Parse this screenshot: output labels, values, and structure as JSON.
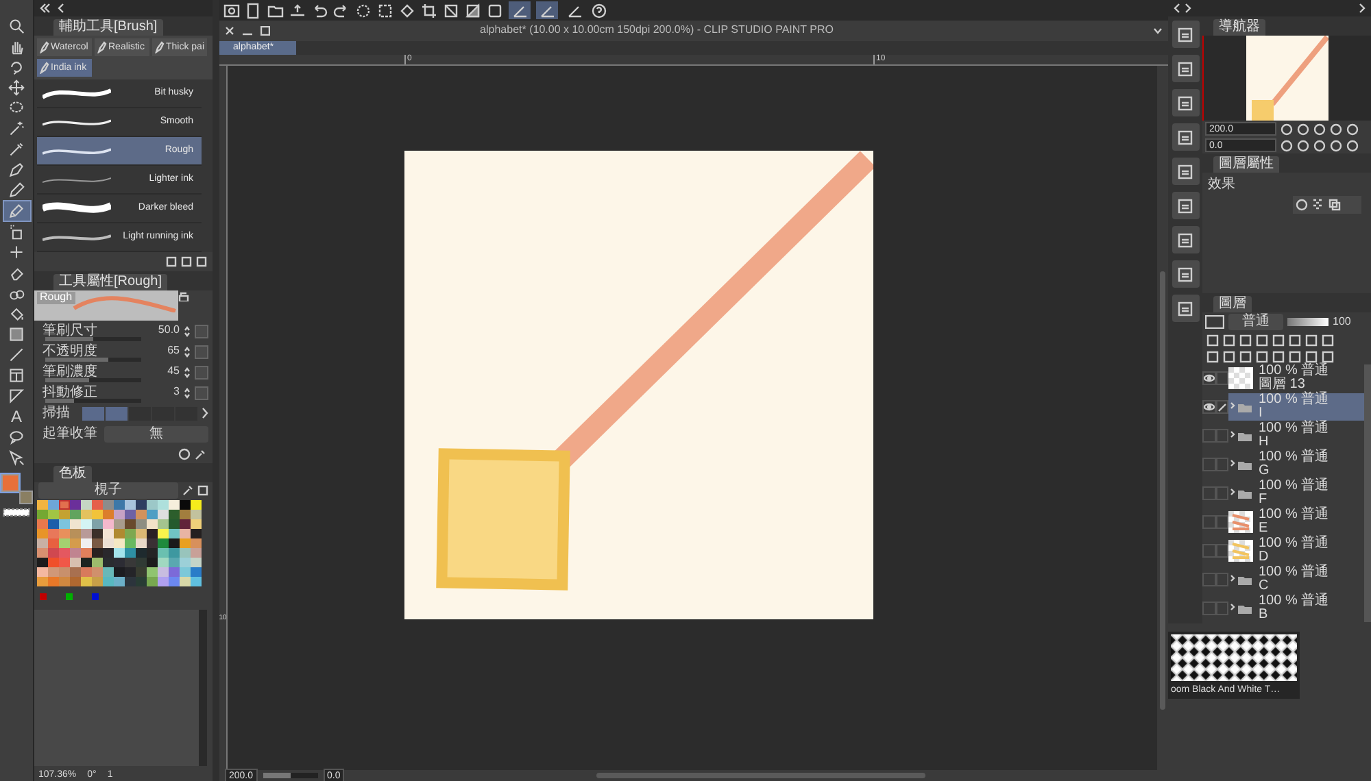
{
  "tools": [
    {
      "kind": "zoom",
      "selected": false
    },
    {
      "kind": "hand",
      "selected": false
    },
    {
      "kind": "rotate",
      "selected": false
    },
    {
      "kind": "move",
      "selected": false
    },
    {
      "kind": "lasso",
      "selected": false
    },
    {
      "kind": "wand",
      "selected": false
    },
    {
      "kind": "eyedropper",
      "selected": false
    },
    {
      "kind": "pen",
      "selected": false
    },
    {
      "kind": "pencil",
      "selected": false
    },
    {
      "kind": "brush",
      "selected": true
    },
    {
      "kind": "airbrush",
      "selected": false
    },
    {
      "kind": "decoration",
      "selected": false
    },
    {
      "kind": "eraser",
      "selected": false
    },
    {
      "kind": "blend",
      "selected": false
    },
    {
      "kind": "fill",
      "selected": false
    },
    {
      "kind": "gradient",
      "selected": false
    },
    {
      "kind": "figure",
      "selected": false
    },
    {
      "kind": "frame",
      "selected": false
    },
    {
      "kind": "ruler",
      "selected": false
    },
    {
      "kind": "text",
      "selected": false,
      "glyph": "A"
    },
    {
      "kind": "balloon",
      "selected": false
    },
    {
      "kind": "correct",
      "selected": false
    }
  ],
  "color_chips": [
    {
      "color": "#e8703a",
      "selected": true
    },
    {
      "color": "#8a7f62",
      "selected": false
    }
  ],
  "subtool": {
    "title": "輔助工具[Brush]",
    "groups": [
      {
        "label": "Watercol",
        "selected": false
      },
      {
        "label": "Realistic",
        "selected": false
      },
      {
        "label": "Thick pai",
        "selected": false
      },
      {
        "label": "India ink",
        "selected": true
      }
    ],
    "brushes": [
      {
        "name": "Bit husky",
        "selected": false
      },
      {
        "name": "Smooth",
        "selected": false
      },
      {
        "name": "Rough",
        "selected": true
      },
      {
        "name": "Lighter ink",
        "selected": false
      },
      {
        "name": "Darker bleed",
        "selected": false
      },
      {
        "name": "Light running ink",
        "selected": false
      }
    ]
  },
  "tool_property": {
    "title": "工具屬性[Rough]",
    "preview_label": "Rough",
    "params": [
      {
        "kind": "slider",
        "label": "筆刷尺寸",
        "value": "50.0",
        "level": 0.5
      },
      {
        "kind": "slider",
        "label": "不透明度",
        "value": "65",
        "level": 0.65
      },
      {
        "kind": "slider",
        "label": "筆刷濃度",
        "value": "45",
        "level": 0.45
      },
      {
        "kind": "slider",
        "label": "抖動修正",
        "value": "3",
        "level": 0.3
      },
      {
        "kind": "steps",
        "label": "掃描",
        "steps": [
          {
            "on": true
          },
          {
            "on": true
          },
          {
            "on": false
          },
          {
            "on": false
          },
          {
            "on": false
          }
        ]
      },
      {
        "kind": "dropdown",
        "label": "起筆收筆",
        "value": "無"
      }
    ]
  },
  "color_palette": {
    "tab_label": "色板",
    "set_name": "梘子",
    "swatches": [
      {
        "color": "#f2b441",
        "selected": false
      },
      {
        "color": "#6ea6d8",
        "selected": false
      },
      {
        "color": "#e2704e",
        "selected": true
      },
      {
        "color": "#6b2f9a",
        "selected": false
      },
      {
        "color": "#c5d6c4",
        "selected": false
      },
      {
        "color": "#e5604a",
        "selected": false
      },
      {
        "color": "#8c8c8c",
        "selected": false
      },
      {
        "color": "#3d78a8",
        "selected": false
      },
      {
        "color": "#a8c4de",
        "selected": false
      },
      {
        "color": "#2e3e62",
        "selected": false
      },
      {
        "color": "#9cc8c8",
        "selected": false
      },
      {
        "color": "#aee0dc",
        "selected": false
      },
      {
        "color": "#f6eedc",
        "selected": false
      },
      {
        "color": "#0a0a0a",
        "selected": false
      },
      {
        "color": "#f5ec1c",
        "selected": false
      },
      {
        "color": "#74a832",
        "selected": false
      },
      {
        "color": "#a2c544",
        "selected": false
      },
      {
        "color": "#c4a232",
        "selected": false
      },
      {
        "color": "#62a45e",
        "selected": false
      },
      {
        "color": "#e3c25e",
        "selected": false
      },
      {
        "color": "#f2c33a",
        "selected": false
      },
      {
        "color": "#dc7e2c",
        "selected": false
      },
      {
        "color": "#c6a2c4",
        "selected": false
      },
      {
        "color": "#6e62a4",
        "selected": false
      },
      {
        "color": "#d2925c",
        "selected": false
      },
      {
        "color": "#4e9ec4",
        "selected": false
      },
      {
        "color": "#dedede",
        "selected": false
      },
      {
        "color": "#2c5e2c",
        "selected": false
      },
      {
        "color": "#a27e3e",
        "selected": false
      },
      {
        "color": "#c2c29e",
        "selected": false
      },
      {
        "color": "#e8784c",
        "selected": false
      },
      {
        "color": "#1d5eaa",
        "selected": false
      },
      {
        "color": "#7cc4de",
        "selected": false
      },
      {
        "color": "#f0e4d0",
        "selected": false
      },
      {
        "color": "#d4f4f4",
        "selected": false
      },
      {
        "color": "#7ea2a8",
        "selected": false
      },
      {
        "color": "#f4b8cc",
        "selected": false
      },
      {
        "color": "#a89c8c",
        "selected": false
      },
      {
        "color": "#684a2c",
        "selected": false
      },
      {
        "color": "#8e8e82",
        "selected": false
      },
      {
        "color": "#f2e2c8",
        "selected": false
      },
      {
        "color": "#a4c48e",
        "selected": false
      },
      {
        "color": "#245a2e",
        "selected": false
      },
      {
        "color": "#62243a",
        "selected": false
      },
      {
        "color": "#f0d07a",
        "selected": false
      },
      {
        "color": "#e89428",
        "selected": false
      },
      {
        "color": "#e8785a",
        "selected": false
      },
      {
        "color": "#e8905c",
        "selected": false
      },
      {
        "color": "#b8905a",
        "selected": false
      },
      {
        "color": "#b89a98",
        "selected": false
      },
      {
        "color": "#3c302a",
        "selected": false
      },
      {
        "color": "#f4e4d4",
        "selected": false
      },
      {
        "color": "#b08a30",
        "selected": false
      },
      {
        "color": "#7ea850",
        "selected": false
      },
      {
        "color": "#dcb874",
        "selected": false
      },
      {
        "color": "#2a2024",
        "selected": false
      },
      {
        "color": "#f8f44c",
        "selected": false
      },
      {
        "color": "#70c4c4",
        "selected": false
      },
      {
        "color": "#e8b4a4",
        "selected": false
      },
      {
        "color": "#242020",
        "selected": false
      },
      {
        "color": "#c8b0a4",
        "selected": false
      },
      {
        "color": "#e86040",
        "selected": false
      },
      {
        "color": "#a4d070",
        "selected": false
      },
      {
        "color": "#d49c4c",
        "selected": false
      },
      {
        "color": "#f0f0f0",
        "selected": false
      },
      {
        "color": "#7a5a44",
        "selected": false
      },
      {
        "color": "#ece0d4",
        "selected": false
      },
      {
        "color": "#f4e8c4",
        "selected": false
      },
      {
        "color": "#68b860",
        "selected": false
      },
      {
        "color": "#e8d8c8",
        "selected": false
      },
      {
        "color": "#3a3034",
        "selected": false
      },
      {
        "color": "#1e8a3c",
        "selected": false
      },
      {
        "color": "#1a1a1a",
        "selected": false
      },
      {
        "color": "#e8a020",
        "selected": false
      },
      {
        "color": "#d8905c",
        "selected": false
      },
      {
        "color": "#d89070",
        "selected": false
      },
      {
        "color": "#d04850",
        "selected": false
      },
      {
        "color": "#e45860",
        "selected": false
      },
      {
        "color": "#c08490",
        "selected": false
      },
      {
        "color": "#e0805c",
        "selected": false
      },
      {
        "color": "#2a2220",
        "selected": false
      },
      {
        "color": "#2a282c",
        "selected": false
      },
      {
        "color": "#a4e4ec",
        "selected": false
      },
      {
        "color": "#2e90a4",
        "selected": false
      },
      {
        "color": "#1e2a2e",
        "selected": false
      },
      {
        "color": "#242424",
        "selected": false
      },
      {
        "color": "#6ac0b0",
        "selected": false
      },
      {
        "color": "#3e98a0",
        "selected": false
      },
      {
        "color": "#98c4bc",
        "selected": false
      },
      {
        "color": "#c8a098",
        "selected": false
      },
      {
        "color": "#1c1c1c",
        "selected": false
      },
      {
        "color": "#f0502a",
        "selected": false
      },
      {
        "color": "#f05848",
        "selected": false
      },
      {
        "color": "#d8c0b0",
        "selected": false
      },
      {
        "color": "#1c2420",
        "selected": false
      },
      {
        "color": "#9cbc6c",
        "selected": false
      },
      {
        "color": "#2a2c30",
        "selected": false
      },
      {
        "color": "#2c2c34",
        "selected": false
      },
      {
        "color": "#383838",
        "selected": false
      },
      {
        "color": "#303a34",
        "selected": false
      },
      {
        "color": "#1c1c1c",
        "selected": false
      },
      {
        "color": "#a0d8c0",
        "selected": false
      },
      {
        "color": "#5aa8b0",
        "selected": false
      },
      {
        "color": "#9cd0d8",
        "selected": false
      },
      {
        "color": "#c4d4c8",
        "selected": false
      },
      {
        "color": "#f4b8a0",
        "selected": false
      },
      {
        "color": "#d09878",
        "selected": false
      },
      {
        "color": "#c8906c",
        "selected": false
      },
      {
        "color": "#a87050",
        "selected": false
      },
      {
        "color": "#d87a5c",
        "selected": false
      },
      {
        "color": "#d0906c",
        "selected": false
      },
      {
        "color": "#68b8b8",
        "selected": false
      },
      {
        "color": "#1c1c20",
        "selected": false
      },
      {
        "color": "#242428",
        "selected": false
      },
      {
        "color": "#383c30",
        "selected": false
      },
      {
        "color": "#90c470",
        "selected": false
      },
      {
        "color": "#c8bce0",
        "selected": false
      },
      {
        "color": "#7c6ad8",
        "selected": false
      },
      {
        "color": "#7cc8d8",
        "selected": false
      },
      {
        "color": "#2a7cc8",
        "selected": false
      },
      {
        "color": "#e89c3c",
        "selected": false
      },
      {
        "color": "#e87828",
        "selected": false
      },
      {
        "color": "#d08840",
        "selected": false
      },
      {
        "color": "#b06830",
        "selected": false
      },
      {
        "color": "#e0c048",
        "selected": false
      },
      {
        "color": "#c8a048",
        "selected": false
      },
      {
        "color": "#58b8c0",
        "selected": false
      },
      {
        "color": "#6cb0c8",
        "selected": false
      },
      {
        "color": "#2c343c",
        "selected": false
      },
      {
        "color": "#283c34",
        "selected": false
      },
      {
        "color": "#78a850",
        "selected": false
      },
      {
        "color": "#b0a0f0",
        "selected": false
      },
      {
        "color": "#6c88f0",
        "selected": false
      },
      {
        "color": "#d8d8a8",
        "selected": false
      },
      {
        "color": "#60c0e0",
        "selected": false
      }
    ]
  },
  "left_status": {
    "zoom": "107.36%",
    "angle": "0°",
    "page": "1"
  },
  "snap_toggles": [
    {
      "on": true
    },
    {
      "on": true
    },
    {
      "on": false
    }
  ],
  "document": {
    "title": "alphabet* (10.00 x 10.00cm 150dpi 200.0%) - CLIP STUDIO PAINT PRO",
    "tabs": [
      {
        "label": "alphabet*",
        "selected": true
      }
    ],
    "ruler_labels": [
      "0",
      "10"
    ],
    "vertical_ruler_labels": [
      "10"
    ],
    "status": {
      "zoom": "200.0",
      "zoom_slider": {
        "level": 0.5
      },
      "angle": "0.0"
    }
  },
  "navigator": {
    "title": "導航器",
    "zoom": "200.0",
    "angle": "0.0"
  },
  "layer_property": {
    "title": "圖層屬性",
    "effect_label": "效果"
  },
  "layers": {
    "title": "圖層",
    "blend_mode": "普通",
    "opacity_slider": {
      "level": 1
    },
    "opacity": "100",
    "items": [
      {
        "kind": "raster",
        "opacity": "100 %",
        "blend": "普通",
        "name": "圖層 13",
        "visible": true,
        "selected": false
      },
      {
        "kind": "folder",
        "opacity": "100 %",
        "blend": "普通",
        "name": "I",
        "visible": true,
        "selected": true
      },
      {
        "kind": "folder",
        "opacity": "100 %",
        "blend": "普通",
        "name": "H",
        "visible": false,
        "selected": false
      },
      {
        "kind": "folder",
        "opacity": "100 %",
        "blend": "普通",
        "name": "G",
        "visible": false,
        "selected": false
      },
      {
        "kind": "folder",
        "opacity": "100 %",
        "blend": "普通",
        "name": "F",
        "visible": false,
        "selected": false
      },
      {
        "kind": "raster",
        "opacity": "100 %",
        "blend": "普通",
        "name": "E",
        "visible": false,
        "selected": false,
        "color": "#e8906c"
      },
      {
        "kind": "raster",
        "opacity": "100 %",
        "blend": "普通",
        "name": "D",
        "visible": false,
        "selected": false,
        "color": "#f2c460"
      },
      {
        "kind": "folder",
        "opacity": "100 %",
        "blend": "普通",
        "name": "C",
        "visible": false,
        "selected": false
      },
      {
        "kind": "folder",
        "opacity": "100 %",
        "blend": "普通",
        "name": "B",
        "visible": false,
        "selected": false
      }
    ]
  },
  "material": {
    "caption": "oom Black And White T…"
  }
}
